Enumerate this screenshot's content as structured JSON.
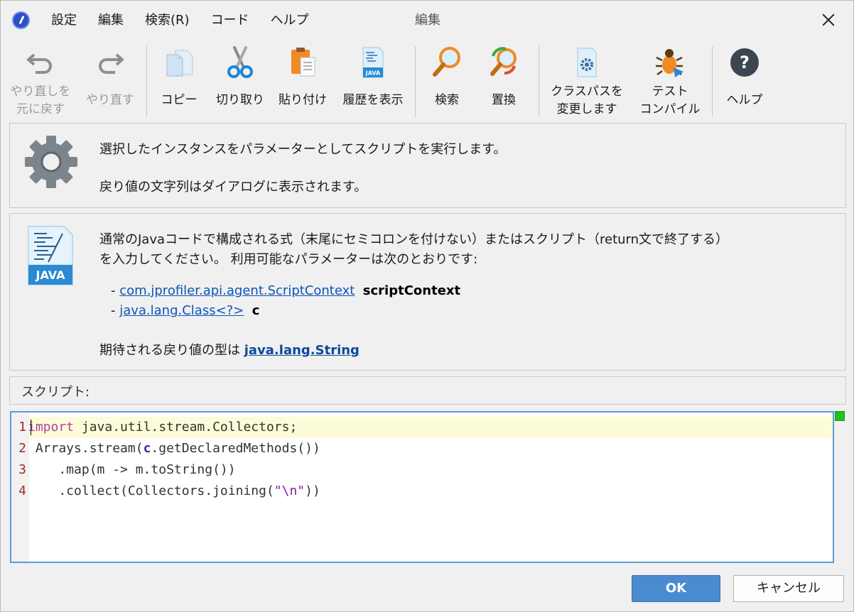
{
  "window": {
    "title": "編集"
  },
  "menu": [
    "設定",
    "編集",
    "検索(R)",
    "コード",
    "ヘルプ"
  ],
  "toolbar": {
    "undo": "やり直しを\n元に戻す",
    "redo": "やり直す",
    "copy": "コピー",
    "cut": "切り取り",
    "paste": "貼り付け",
    "history": "履歴を表示",
    "find": "検索",
    "replace": "置換",
    "classpath": "クラスパスを\n変更します",
    "test_compile": "テスト\nコンパイル",
    "help": "ヘルプ"
  },
  "description": {
    "line1": "選択したインスタンスをパラメーターとしてスクリプトを実行します。",
    "line2": "戻り値の文字列はダイアログに表示されます。"
  },
  "info": {
    "line1": "通常のJavaコードで構成される式（末尾にセミコロンを付けない）またはスクリプト（return文で終了する）",
    "line2": "を入力してください。 利用可能なパラメーターは次のとおりです:",
    "params": [
      {
        "prefix": "- ",
        "type": "com.jprofiler.api.agent.ScriptContext",
        "name": "scriptContext"
      },
      {
        "prefix": "- ",
        "type": "java.lang.Class<?>",
        "name": "c"
      }
    ],
    "return_prefix": "期待される戻り値の型は ",
    "return_type": "java.lang.String"
  },
  "script_label": "スクリプト:",
  "code": {
    "lines": [
      {
        "n": "1",
        "kw": "import",
        "rest": " java.util.stream.Collectors;"
      },
      {
        "n": "2",
        "pre": " Arrays.stream(",
        "var": "c",
        "post": ".getDeclaredMethods())"
      },
      {
        "n": "3",
        "text": "    .map(m -> m.toString())"
      },
      {
        "n": "4",
        "pre": "    .collect(Collectors.joining(",
        "str": "\"\\n\"",
        "post": "))"
      }
    ]
  },
  "buttons": {
    "ok": "OK",
    "cancel": "キャンセル"
  },
  "colors": {
    "accent": "#4a8bd0",
    "link": "#0a55b8",
    "status_ok": "#1fc21f"
  }
}
